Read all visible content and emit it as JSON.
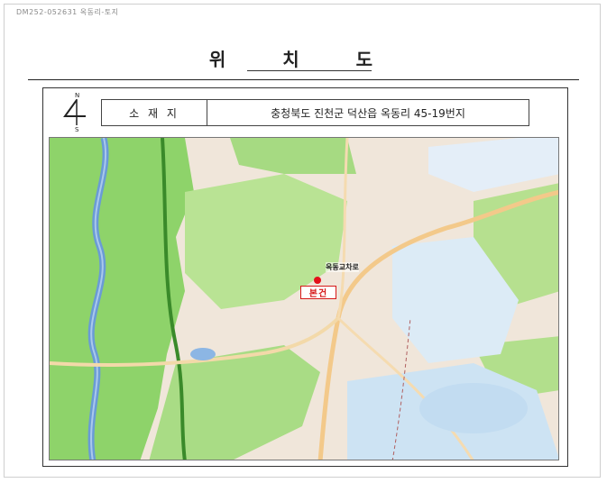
{
  "header": {
    "doc_id": "DM252-052631 옥동리-토지"
  },
  "title": "위 치 도",
  "compass": {
    "north": "N",
    "south": "S"
  },
  "location": {
    "label": "소 재 지",
    "address": "충청북도 진천군 덕산읍 옥동리 45-19번지"
  },
  "map": {
    "subject_label": "본건",
    "nearby_label": "옥동교차로",
    "colors": {
      "marker": "#e3101a",
      "forest": "#8ed36a",
      "river": "#6a9bd6",
      "urban": "#cde3f3",
      "land": "#f0e6da"
    }
  }
}
